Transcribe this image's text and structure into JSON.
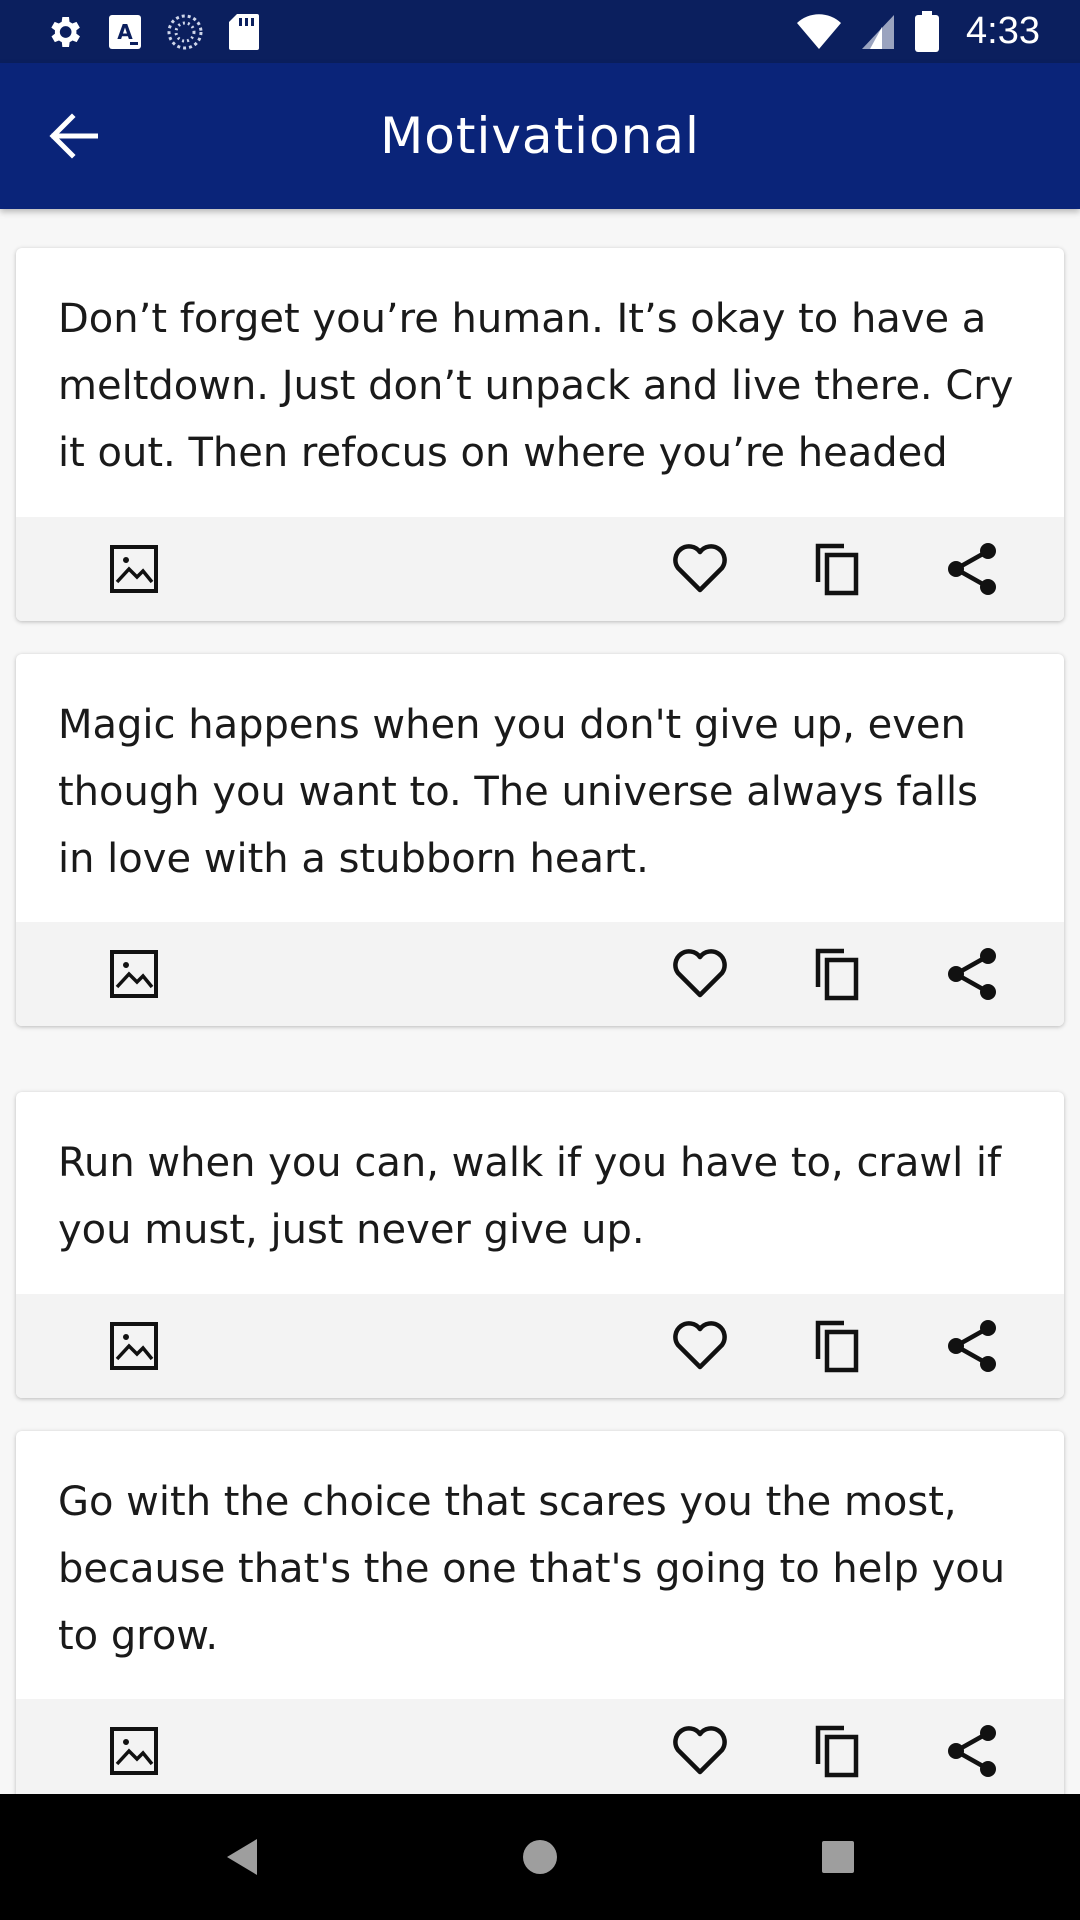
{
  "status_bar": {
    "time": "4:33",
    "left_icons": [
      "settings-icon",
      "accessibility-app-icon",
      "sync-icon",
      "sd-card-icon"
    ],
    "right_icons": [
      "wifi-icon",
      "cell-signal-icon",
      "battery-icon"
    ]
  },
  "app_bar": {
    "title": "Motivational",
    "back_icon": "arrow-back-icon",
    "color": "#0a2479"
  },
  "quotes": [
    {
      "text": "Don’t forget you’re human. It’s okay to have a meltdown. Just don’t unpack and live there. Cry it out. Then refocus on where you’re headed"
    },
    {
      "text": "Magic happens when you don't give up, even though you want to. The universe always falls in love with a stubborn heart."
    },
    {
      "text": "Run when you can, walk if you have to, crawl if you must, just never give up."
    },
    {
      "text": "Go with the choice that scares you the most, because that's the one that's going to help you to grow."
    }
  ],
  "card_actions": [
    "image-icon",
    "heart-icon",
    "copy-icon",
    "share-icon"
  ],
  "nav_bar": [
    "back-triangle-icon",
    "home-circle-icon",
    "recents-square-icon"
  ]
}
